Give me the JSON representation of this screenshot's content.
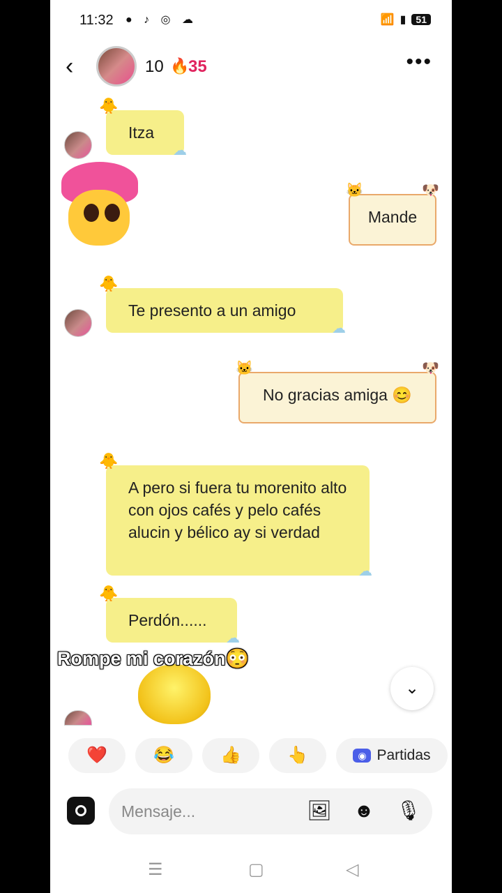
{
  "status": {
    "time": "11:32",
    "battery": "51"
  },
  "header": {
    "streak": "10",
    "fire_count": "35"
  },
  "messages": [
    {
      "side": "in",
      "text": "Itza"
    },
    {
      "side": "out",
      "text": "Mande"
    },
    {
      "side": "in",
      "text": "Te presento a un amigo"
    },
    {
      "side": "out",
      "text": "No gracias amiga 😊"
    },
    {
      "side": "in",
      "text": "A pero si fuera tu morenito alto con ojos cafés y pelo cafés alucin y bélico ay si verdad"
    },
    {
      "side": "in",
      "text": "Perdón......"
    }
  ],
  "caption": "Rompe mi corazón😳",
  "quick_reactions": [
    "❤️",
    "😂",
    "👍",
    "👆"
  ],
  "partidas_label": "Partidas",
  "composer": {
    "placeholder": "Mensaje..."
  },
  "colors": {
    "bubble_in": "#f6ef8a",
    "bubble_out": "#fbf3d6",
    "accent": "#e0245e"
  }
}
